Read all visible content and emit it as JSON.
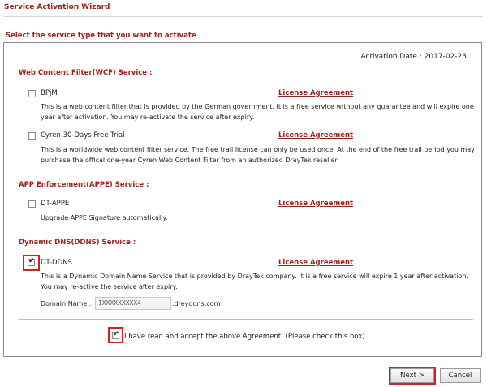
{
  "header": {
    "title": "Service Activation Wizard",
    "prompt": "Select the service type that you want to activate"
  },
  "activation_date": "Activation Date : 2017-02-23",
  "sections": {
    "wcf": {
      "title": "Web Content Filter(WCF) Service :",
      "bpjm": {
        "name": "BPjM",
        "license": "License Agreement",
        "description": "This is a web content filter that is provided by the German government. It is a free service without any guarantee and will expire one year after activation. You may re-activate the service after expiry.",
        "checked": false
      },
      "cyren": {
        "name": "Cyren 30-Days Free Trial",
        "license": "License Agreement",
        "description": "This is a worldwide web content filter service. The free trail license can only be used once. At the end of the free trail period you may purchase the offical one-year Cyren Web Content Filter from an authorized DrayTek reseller.",
        "checked": false
      }
    },
    "appe": {
      "title": "APP Enforcement(APPE) Service :",
      "dt_appe": {
        "name": "DT-APPE",
        "license": "License Agreement",
        "description": "Upgrade APPE Signature automatically.",
        "checked": false
      }
    },
    "ddns": {
      "title": "Dynamic DNS(DDNS) Service :",
      "dt_ddns": {
        "name": "DT-DDNS",
        "license": "License Agreement",
        "description": "This is a Dynamic Domain Name Service that is provided by DrayTek company. It is a free service will expire 1 year after activation. You may re-active the service after expiry.",
        "checked": true
      },
      "domain_label": "Domain Name :",
      "domain_value": "1XXXXXXXXX4",
      "domain_suffix": ".dreyddns.com"
    }
  },
  "agreement": {
    "text": "I have read and accept the above Agreement. (Please check this box).",
    "checked": true
  },
  "buttons": {
    "next": "Next >",
    "cancel": "Cancel"
  },
  "colors": {
    "accent": "#a02020",
    "highlight": "#d91e1e"
  }
}
